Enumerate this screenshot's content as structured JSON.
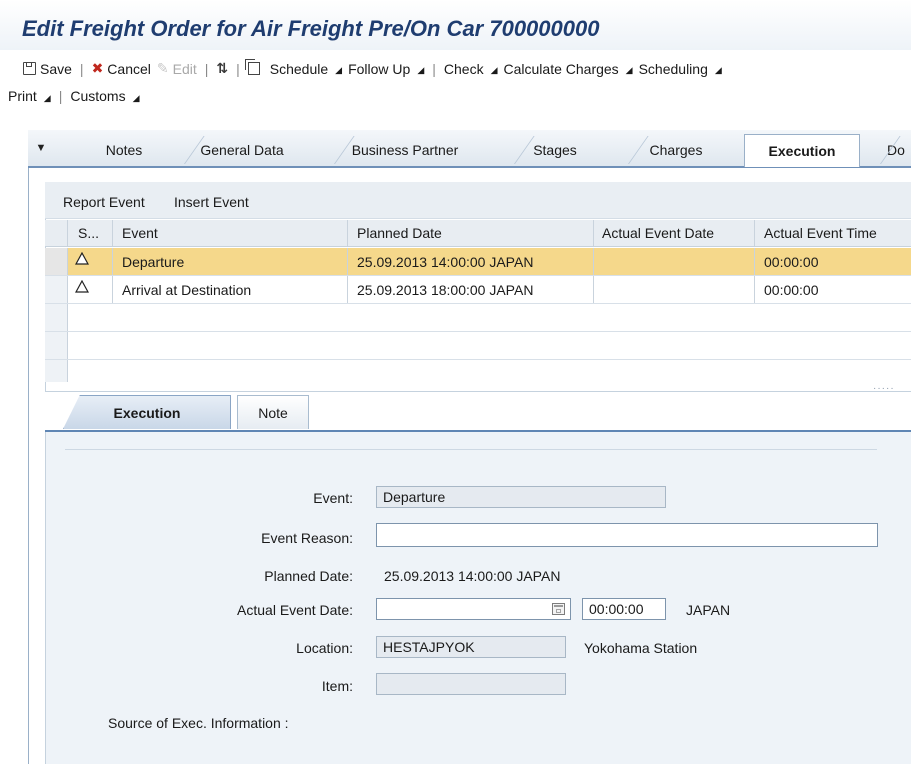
{
  "title": "Edit Freight Order for Air Freight Pre/On Car 700000000",
  "toolbar": {
    "save": "Save",
    "cancel": "Cancel",
    "edit": "Edit",
    "schedule": "Schedule",
    "follow_up": "Follow Up",
    "check": "Check",
    "calculate_charges": "Calculate Charges",
    "scheduling": "Scheduling",
    "print": "Print",
    "customs": "Customs"
  },
  "tabs": [
    {
      "label": "Notes"
    },
    {
      "label": "General Data"
    },
    {
      "label": "Business Partner"
    },
    {
      "label": "Stages"
    },
    {
      "label": "Charges"
    },
    {
      "label": "Execution"
    },
    {
      "label": "Do"
    }
  ],
  "table": {
    "actions": {
      "report_event": "Report Event",
      "insert_event": "Insert Event"
    },
    "columns": {
      "status": "S...",
      "event": "Event",
      "planned_date": "Planned Date",
      "actual_event_date": "Actual Event Date",
      "actual_event_time": "Actual Event Time"
    },
    "rows": [
      {
        "event": "Departure",
        "planned_date": "25.09.2013 14:00:00 JAPAN",
        "actual_event_date": "",
        "actual_event_time": "00:00:00"
      },
      {
        "event": "Arrival at Destination",
        "planned_date": "25.09.2013 18:00:00 JAPAN",
        "actual_event_date": "",
        "actual_event_time": "00:00:00"
      }
    ]
  },
  "detail_tabs": {
    "execution": "Execution",
    "note": "Note"
  },
  "form": {
    "event_label": "Event:",
    "event_value": "Departure",
    "event_reason_label": "Event Reason:",
    "event_reason_value": "",
    "planned_date_label": "Planned Date:",
    "planned_date_value": "25.09.2013 14:00:00 JAPAN",
    "actual_event_date_label": "Actual Event Date:",
    "actual_event_date_value": "",
    "actual_event_time_value": "00:00:00",
    "timezone": "JAPAN",
    "location_label": "Location:",
    "location_value": "HESTAJPYOK",
    "location_description": "Yokohama Station",
    "item_label": "Item:",
    "item_value": "",
    "source_label": "Source of Exec. Information :"
  },
  "colors": {
    "title": "#1f3d70",
    "selected_row": "#f5d88b",
    "form_background": "#eef3f8",
    "tab_border": "#6f90b8"
  },
  "icons": [
    "save-icon",
    "cancel-icon",
    "edit-icon",
    "refresh-icon",
    "copy-icon",
    "tab-menu-icon",
    "warning-icon",
    "calendar-icon",
    "dropdown-triangle-icon"
  ]
}
